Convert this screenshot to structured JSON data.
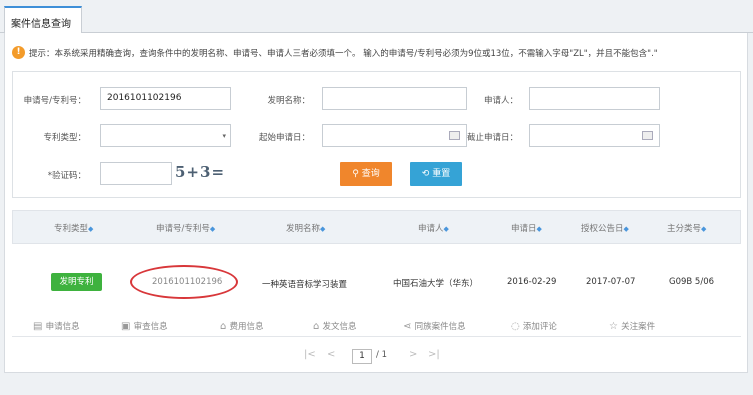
{
  "tab": {
    "label": "案件信息查询"
  },
  "hint": {
    "text": "提示：本系统采用精确查询，查询条件中的发明名称、申请号、申请人三者必须填一个。 输入的申请号/专利号必须为9位或13位，不需输入字母\"ZL\"，并且不能包含\".\""
  },
  "form": {
    "app_no_label": "申请号/专利号：",
    "app_no_value": "2016101102196",
    "invention_name_label": "发明名称：",
    "applicant_label": "申请人：",
    "patent_type_label": "专利类型：",
    "start_date_label": "起始申请日：",
    "end_date_label": "截止申请日：",
    "captcha_label": "*验证码：",
    "captcha_image_text": "5+3=",
    "query_button": "查询",
    "reset_button": "重置"
  },
  "table": {
    "headers": [
      "专利类型",
      "申请号/专利号",
      "发明名称",
      "申请人",
      "申请日",
      "授权公告日",
      "主分类号"
    ],
    "row": {
      "type_badge": "发明专利",
      "app_no": "2016101102196",
      "title": "一种英语音标学习装置",
      "applicant": "中国石油大学（华东）",
      "app_date": "2016-02-29",
      "grant_date": "2017-07-07",
      "ipc": "G09B 5/06"
    }
  },
  "actions": [
    {
      "label": "申请信息",
      "icon": "document-icon"
    },
    {
      "label": "审查信息",
      "icon": "image-icon"
    },
    {
      "label": "费用信息",
      "icon": "fee-icon"
    },
    {
      "label": "发文信息",
      "icon": "letter-icon"
    },
    {
      "label": "同族案件信息",
      "icon": "share-icon"
    },
    {
      "label": "添加评论",
      "icon": "comment-icon"
    },
    {
      "label": "关注案件",
      "icon": "star-icon"
    }
  ],
  "pagination": {
    "current": "1",
    "total": "/ 1"
  }
}
